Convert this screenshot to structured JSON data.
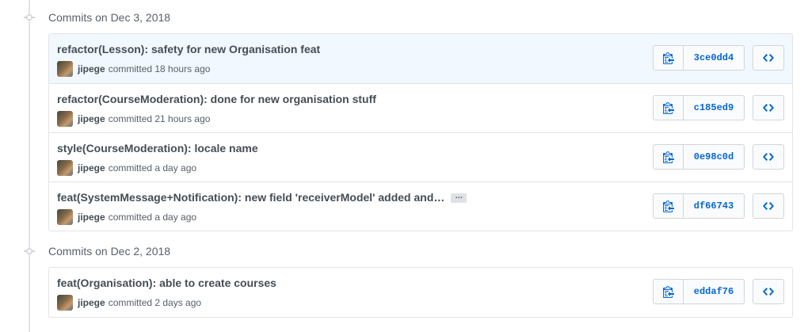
{
  "groups": [
    {
      "title": "Commits on Dec 3, 2018",
      "commits": [
        {
          "title": "refactor(Lesson): safety for new Organisation feat",
          "author": "jipege",
          "committed": "committed 18 hours ago",
          "sha": "3ce0dd4"
        },
        {
          "title": "refactor(CourseModeration): done for new organisation stuff",
          "author": "jipege",
          "committed": "committed 21 hours ago",
          "sha": "c185ed9"
        },
        {
          "title": "style(CourseModeration): locale name",
          "author": "jipege",
          "committed": "committed a day ago",
          "sha": "0e98c0d"
        },
        {
          "title": "feat(SystemMessage+Notification): new field 'receiverModel' added and…",
          "author": "jipege",
          "committed": "committed a day ago",
          "sha": "df66743",
          "ellipsis": "…"
        }
      ]
    },
    {
      "title": "Commits on Dec 2, 2018",
      "commits": [
        {
          "title": "feat(Organisation): able to create courses",
          "author": "jipege",
          "committed": "committed 2 days ago",
          "sha": "eddaf76"
        }
      ]
    }
  ],
  "icons": {
    "commit_node": "git-commit-icon",
    "copy": "clipboard-icon",
    "browse": "code-icon"
  },
  "colors": {
    "link": "#0366d6",
    "highlight_row": "#f1f8ff",
    "border": "#e1e4e8"
  }
}
